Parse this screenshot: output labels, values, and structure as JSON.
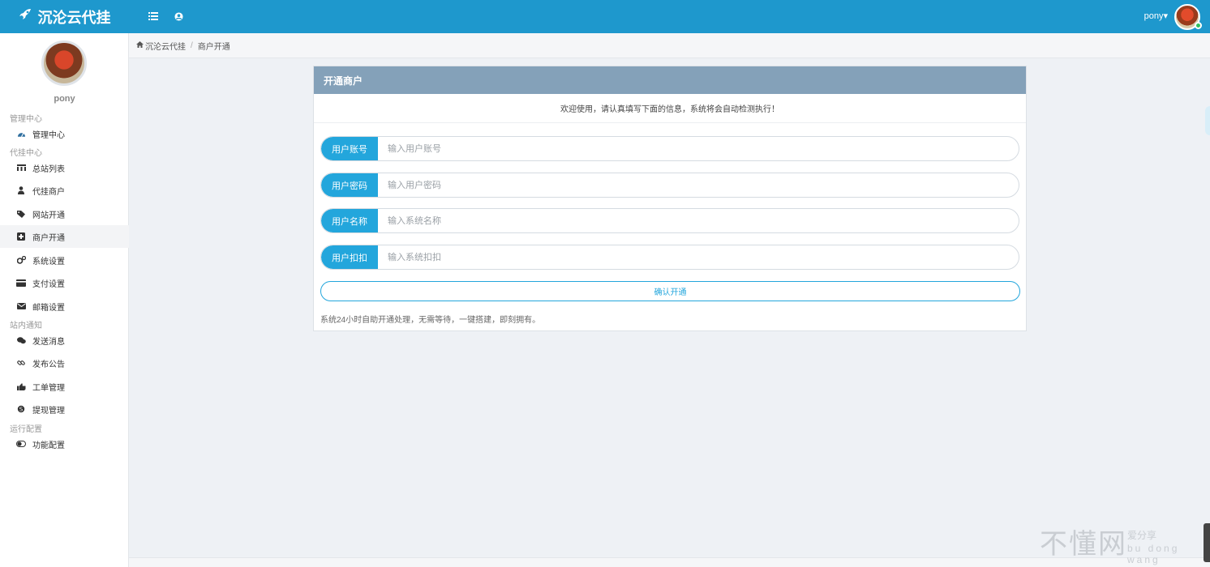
{
  "app": {
    "title": "沉沦云代挂"
  },
  "topbar": {
    "username": "pony",
    "caret": "▾"
  },
  "sidebar": {
    "username": "pony",
    "sections": [
      {
        "title": "管理中心",
        "items": [
          {
            "label": "管理中心",
            "icon": "dashboard-icon"
          }
        ]
      },
      {
        "title": "代挂中心",
        "items": [
          {
            "label": "总站列表",
            "icon": "bars-icon"
          },
          {
            "label": "代挂商户",
            "icon": "user-icon"
          },
          {
            "label": "网站开通",
            "icon": "tag-icon"
          },
          {
            "label": "商户开通",
            "icon": "plus-square-icon",
            "active": true
          },
          {
            "label": "系统设置",
            "icon": "cogs-icon"
          },
          {
            "label": "支付设置",
            "icon": "credit-card-icon"
          },
          {
            "label": "邮箱设置",
            "icon": "envelope-icon"
          }
        ]
      },
      {
        "title": "站内通知",
        "items": [
          {
            "label": "发送消息",
            "icon": "chat-icon"
          },
          {
            "label": "发布公告",
            "icon": "link-icon"
          },
          {
            "label": "工单管理",
            "icon": "thumbs-up-icon"
          },
          {
            "label": "提现管理",
            "icon": "skype-icon"
          }
        ]
      },
      {
        "title": "运行配置",
        "items": [
          {
            "label": "功能配置",
            "icon": "toggle-icon"
          }
        ]
      }
    ]
  },
  "breadcrumb": {
    "home": "沉沦云代挂",
    "sep": "/",
    "current": "商户开通"
  },
  "panel": {
    "title": "开通商户",
    "notice": "欢迎使用，请认真填写下面的信息，系统将会自动检测执行！",
    "fields": [
      {
        "label": "用户账号",
        "placeholder": "输入用户账号",
        "value": ""
      },
      {
        "label": "用户密码",
        "placeholder": "输入用户密码",
        "value": ""
      },
      {
        "label": "用户名称",
        "placeholder": "输入系统名称",
        "value": ""
      },
      {
        "label": "用户扣扣",
        "placeholder": "输入系统扣扣",
        "value": ""
      }
    ],
    "submit": "确认开通",
    "footer": "系统24小时自助开通处理，无需等待，一键搭建，即刻拥有。"
  },
  "watermark": {
    "main": "不懂网",
    "sub1": "爱分享",
    "sub2": "bu dong wang"
  },
  "colors": {
    "topbar": "#1e98cd",
    "accent": "#23a6dc",
    "panel_header": "#84a1b9"
  }
}
